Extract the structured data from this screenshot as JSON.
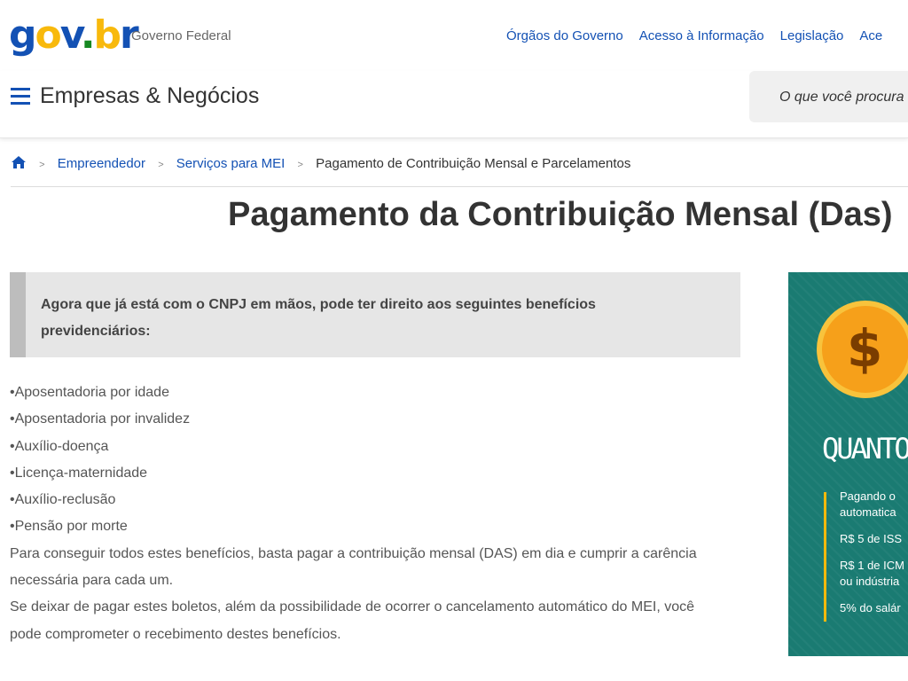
{
  "header": {
    "logo_text": "gov.br",
    "subtitle": "Governo Federal",
    "links": [
      "Órgãos do Governo",
      "Acesso à Informação",
      "Legislação",
      "Ace"
    ]
  },
  "menubar": {
    "site_title": "Empresas & Negócios",
    "search_placeholder": "O que você procura"
  },
  "breadcrumb": {
    "items": [
      "Empreendedor",
      "Serviços para MEI"
    ],
    "current": "Pagamento de Contribuição Mensal e Parcelamentos"
  },
  "page": {
    "title": "Pagamento da Contribuição Mensal (Das)",
    "intro": "Agora que já está com o CNPJ em mãos, pode ter direito aos seguintes benefícios previdenciários:",
    "benefits": [
      "Aposentadoria por idade",
      "Aposentadoria por invalidez",
      "Auxílio-doença",
      "Licença-maternidade",
      "Auxílio-reclusão",
      "Pensão por morte"
    ],
    "paragraph1": "Para conseguir todos estes benefícios, basta pagar a contribuição mensal (DAS) em dia e cumprir a carência necessária para cada um.",
    "paragraph2": "Se deixar de pagar estes boletos, além da possibilidade de ocorrer o cancelamento automático do MEI, você pode comprometer o recebimento destes benefícios."
  },
  "banner": {
    "coin_symbol": "$",
    "title": "QUANTO",
    "lines": [
      "Pagando o",
      "automatica",
      "R$ 5 de ISS",
      "R$ 1 de ICM",
      "ou indústria",
      "5% do salár"
    ]
  },
  "colors": {
    "brand_blue": "#1351b4",
    "banner_green": "#1a7b72",
    "accent_yellow": "#f8b90c"
  }
}
